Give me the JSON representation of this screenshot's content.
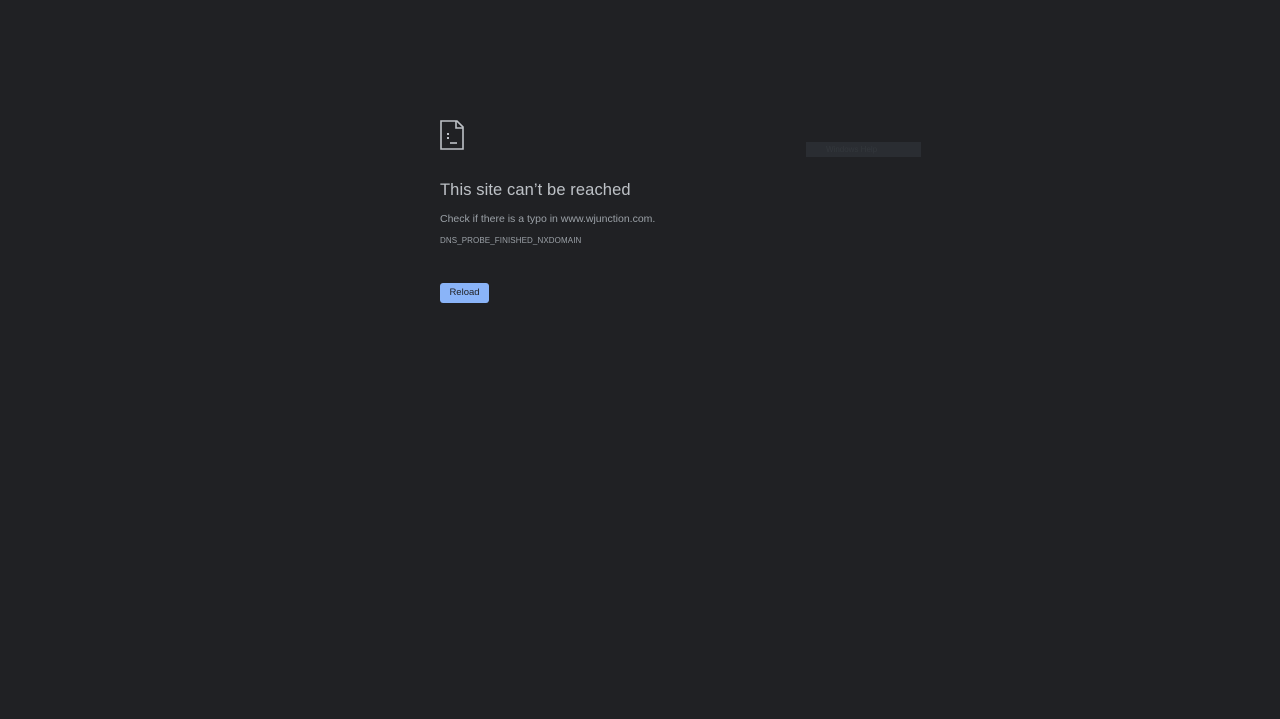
{
  "icon": {
    "name": "sad-document-icon",
    "color": "#bdc1c6"
  },
  "error": {
    "title": "This site can’t be reached",
    "suggestion": "Check if there is a typo in www.wjunction.com.",
    "code": "DNS_PROBE_FINISHED_NXDOMAIN"
  },
  "actions": {
    "reload_label": "Reload"
  },
  "overlay": {
    "faint_label": "Windows Help"
  },
  "colors": {
    "background": "#202124",
    "title": "#bdc1c6",
    "text": "#9aa0a6",
    "accent": "#8ab4f8"
  }
}
